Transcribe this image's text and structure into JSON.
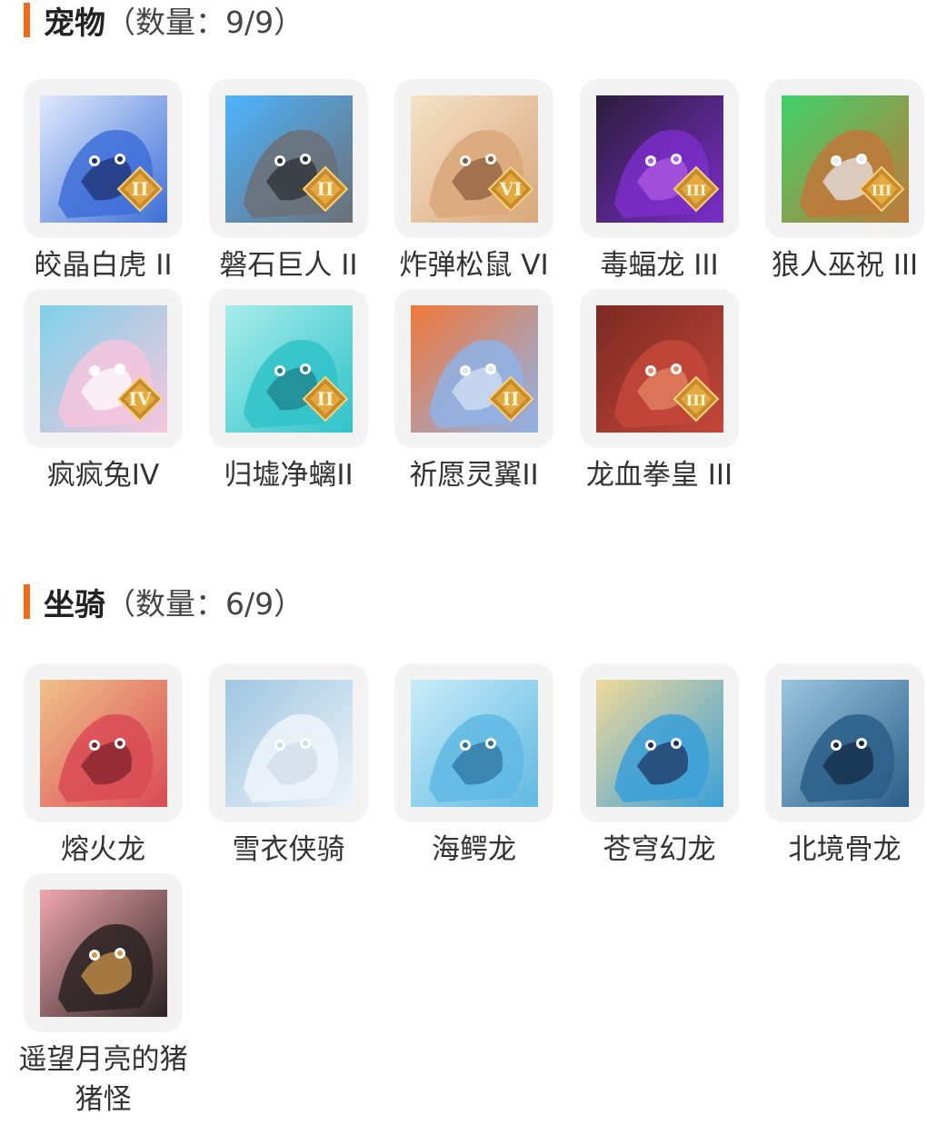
{
  "pets": {
    "title": "宠物",
    "count": "（数量：9/9）",
    "items": [
      {
        "label": "皎晶白虎 II",
        "rank": "II",
        "icon": "white-tiger-icon",
        "colors": [
          "#3d6ed8",
          "#dfe9fb",
          "#1b2d6b"
        ]
      },
      {
        "label": "磐石巨人 II",
        "rank": "II",
        "icon": "stone-giant-icon",
        "colors": [
          "#6b7075",
          "#4db3ff",
          "#2a2d30"
        ]
      },
      {
        "label": "炸弹松鼠 VI",
        "rank": "VI",
        "icon": "bomb-squirrel-icon",
        "colors": [
          "#d9a77a",
          "#f4e2c8",
          "#8a5a3a"
        ]
      },
      {
        "label": "毒蝠龙 III",
        "rank": "III",
        "icon": "poison-bat-dragon-icon",
        "colors": [
          "#7b2ec9",
          "#2a1d3a",
          "#b45ce6"
        ]
      },
      {
        "label": "狼人巫祝 III",
        "rank": "III",
        "icon": "werewolf-shaman-icon",
        "colors": [
          "#c0783a",
          "#3fd26a",
          "#e8ecf5"
        ]
      },
      {
        "label": "疯疯兔IV",
        "rank": "IV",
        "icon": "crazy-rabbit-icon",
        "colors": [
          "#f6c6dd",
          "#7fd1e8",
          "#ffffff"
        ]
      },
      {
        "label": "归墟净螭II",
        "rank": "II",
        "icon": "water-dragon-icon",
        "colors": [
          "#2fc3c9",
          "#a8ece9",
          "#1b7d84"
        ]
      },
      {
        "label": "祈愿灵翼II",
        "rank": "II",
        "icon": "prayer-bird-icon",
        "colors": [
          "#8fb3e8",
          "#f0783a",
          "#d8e6f7"
        ]
      },
      {
        "label": "龙血拳皇 III",
        "rank": "III",
        "icon": "dragon-blood-boxer-icon",
        "colors": [
          "#c4473a",
          "#7a2a22",
          "#e58a6a"
        ]
      }
    ]
  },
  "mounts": {
    "title": "坐骑",
    "count": "（数量：6/9）",
    "items": [
      {
        "label": "熔火龙",
        "icon": "lava-dragon-icon",
        "colors": [
          "#d94a55",
          "#f0c18a",
          "#7a1f2a"
        ]
      },
      {
        "label": "雪衣侠骑",
        "icon": "snow-horse-icon",
        "colors": [
          "#eef3f9",
          "#9fc7e0",
          "#cfdbe8"
        ]
      },
      {
        "label": "海鳄龙",
        "icon": "sea-crocodile-dragon-icon",
        "colors": [
          "#5fb9e3",
          "#c9ecf7",
          "#2b6f9c"
        ]
      },
      {
        "label": "苍穹幻龙",
        "icon": "sky-phantom-dragon-icon",
        "colors": [
          "#3aa0d8",
          "#f0d99a",
          "#1d2e5a"
        ]
      },
      {
        "label": "北境骨龙",
        "icon": "northern-bone-dragon-icon",
        "colors": [
          "#2a5e88",
          "#9cc6df",
          "#13283f"
        ]
      },
      {
        "label": "遥望月亮的猪猪怪",
        "icon": "moon-pig-icon",
        "colors": [
          "#2a2222",
          "#f0a7ae",
          "#d49a4a"
        ]
      }
    ]
  }
}
